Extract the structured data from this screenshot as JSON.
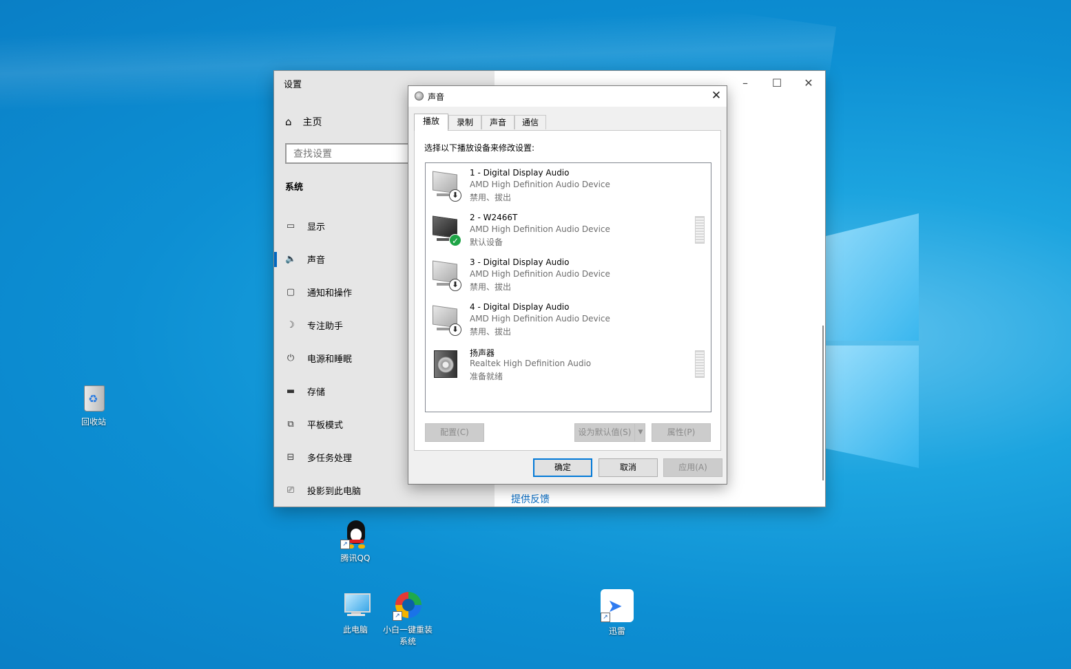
{
  "desktop": {
    "icons": [
      {
        "label": "回收站"
      },
      {
        "label": "腾讯QQ"
      },
      {
        "label": "此电脑"
      },
      {
        "label": "小白一键重装系统"
      },
      {
        "label": "迅雷"
      }
    ]
  },
  "settings": {
    "title": "设置",
    "home": "主页",
    "search_placeholder": "查找设置",
    "section": "系统",
    "nav": [
      {
        "label": "显示",
        "icon": "display-icon"
      },
      {
        "label": "声音",
        "icon": "speaker-icon",
        "selected": true
      },
      {
        "label": "通知和操作",
        "icon": "notification-icon"
      },
      {
        "label": "专注助手",
        "icon": "moon-icon"
      },
      {
        "label": "电源和睡眠",
        "icon": "power-icon"
      },
      {
        "label": "存储",
        "icon": "storage-icon"
      },
      {
        "label": "平板模式",
        "icon": "tablet-icon"
      },
      {
        "label": "多任务处理",
        "icon": "multitask-icon"
      },
      {
        "label": "投影到此电脑",
        "icon": "project-icon"
      }
    ],
    "feedback_link": "提供反馈",
    "controls": {
      "minimize": "–",
      "maximize": "☐",
      "close": "✕"
    }
  },
  "sound_dialog": {
    "title": "声音",
    "close": "✕",
    "tabs": [
      {
        "label": "播放",
        "active": true
      },
      {
        "label": "录制"
      },
      {
        "label": "声音"
      },
      {
        "label": "通信"
      }
    ],
    "instruction": "选择以下播放设备来修改设置:",
    "devices": [
      {
        "name": "1 - Digital Display Audio",
        "driver": "AMD High Definition Audio Device",
        "status": "禁用、拔出"
      },
      {
        "name": "2 - W2466T",
        "driver": "AMD High Definition Audio Device",
        "status": "默认设备"
      },
      {
        "name": "3 - Digital Display Audio",
        "driver": "AMD High Definition Audio Device",
        "status": "禁用、拔出"
      },
      {
        "name": "4 - Digital Display Audio",
        "driver": "AMD High Definition Audio Device",
        "status": "禁用、拔出"
      },
      {
        "name": "扬声器",
        "driver": "Realtek High Definition Audio",
        "status": "准备就绪"
      }
    ],
    "buttons": {
      "configure": "配置(C)",
      "set_default": "设为默认值(S)",
      "properties": "属性(P)",
      "ok": "确定",
      "cancel": "取消",
      "apply": "应用(A)"
    }
  },
  "colors": {
    "accent": "#0067c0",
    "default_button_border": "#0078d7",
    "ok_badge": "#1ea446"
  }
}
